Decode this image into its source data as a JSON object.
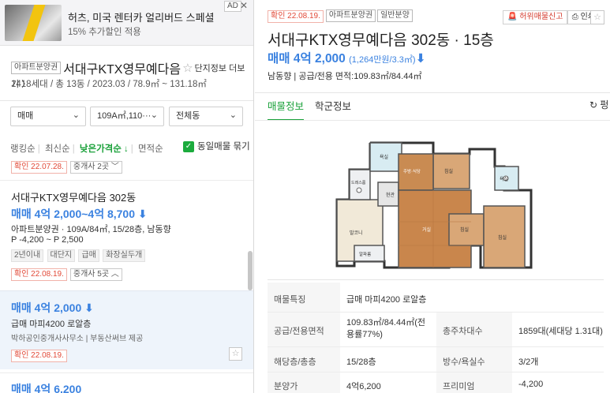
{
  "ad": {
    "badge": "AD",
    "close": "✕",
    "title": "허츠, 미국 렌터카 얼리버드 스페셜",
    "subtitle": "15% 추가할인 적용"
  },
  "complex": {
    "type_tag": "아파트분양권",
    "name": "서대구KTX영무예다음",
    "star": "☆",
    "more_link": "단지정보 더보기 〉",
    "stats": "1418세대 / 총 13동 / 2023.03 / 78.9㎡ ~ 131.18㎡"
  },
  "filters": {
    "deal_type": "매매",
    "area": "109A㎡,110···",
    "building": "전체동"
  },
  "sort": {
    "options": [
      "랭킹순",
      "최신순",
      "낮은가격순 ↓",
      "면적순"
    ],
    "active_index": 2,
    "dup_checkbox_label": "동일매물 묶기"
  },
  "listings": {
    "cut_conf": "확인 22.07.28.",
    "cut_agent": "중개사 2곳 ﹀",
    "item1": {
      "title": "서대구KTX영무예다음 302동",
      "price": "매매 4억 2,000~4억 8,700",
      "price_arrow": "⬇",
      "detail": "아파트분양권 · 109A/84㎡, 15/28층, 남동향",
      "premium": "P -4,200 ~ P 2,500",
      "tags": [
        "2년이내",
        "대단지",
        "급매",
        "화장실두개"
      ],
      "conf": "확인 22.08.19.",
      "agents": "중개사 5곳 ︿"
    },
    "item2": {
      "price": "매매 4억 2,000",
      "price_arrow": "⬇",
      "desc": "급매 마피4200 로알층",
      "agent": "박하공인중개사사무소 | 부동산써브 제공",
      "conf": "확인 22.08.19.",
      "fav": "☆"
    },
    "item3": {
      "price": "매매 4억 6,200"
    }
  },
  "detail": {
    "conf": "확인 22.08.19.",
    "tags": [
      "아파트분양권",
      "일반분양"
    ],
    "report_button": "허위매물신고",
    "print_button": "인쇄",
    "fav": "☆",
    "title": "서대구KTX영무예다음 302동 · 15층",
    "price": "매매 4억 2,000",
    "price_per_m2": "(1,264만원/3.3㎡)",
    "price_arrow": "⬇",
    "summary": "남동향 | 공급/전용 면적:109.83㎡/84.44㎡",
    "tabs": [
      "매물정보",
      "학군정보"
    ],
    "refresh": "↻ 펑",
    "floorplan_labels": {
      "entrance": "현관",
      "dress": "드레스룸",
      "bath1": "욕실",
      "room1": "침실",
      "bath2": "욕실",
      "kitchen": "주방·식당",
      "living": "거실",
      "room2": "침실",
      "room3": "침실",
      "balcony": "발코니",
      "alpha": "알파룸"
    },
    "table": {
      "feature_label": "매물특징",
      "feature_value": "급매 마피4200 로알층",
      "area_label": "공급/전용면적",
      "area_value_1": "109.83㎡/84.44㎡(전",
      "area_value_2": "용률77%)",
      "parking_label": "총주차대수",
      "parking_value": "1859대(세대당 1.31대)",
      "floor_label": "해당층/총층",
      "floor_value": "15/28층",
      "rooms_label": "방수/욕실수",
      "rooms_value": "3/2개",
      "sale_label": "분양가",
      "sale_value": "4억6,200",
      "premium_label": "프리미엄",
      "premium_value": "-4,200"
    }
  },
  "colors": {
    "accent_green": "#1aa13a",
    "price_blue": "#3b82e0",
    "confirm_red": "#e24a38",
    "selected_bg": "#eef4fb"
  }
}
